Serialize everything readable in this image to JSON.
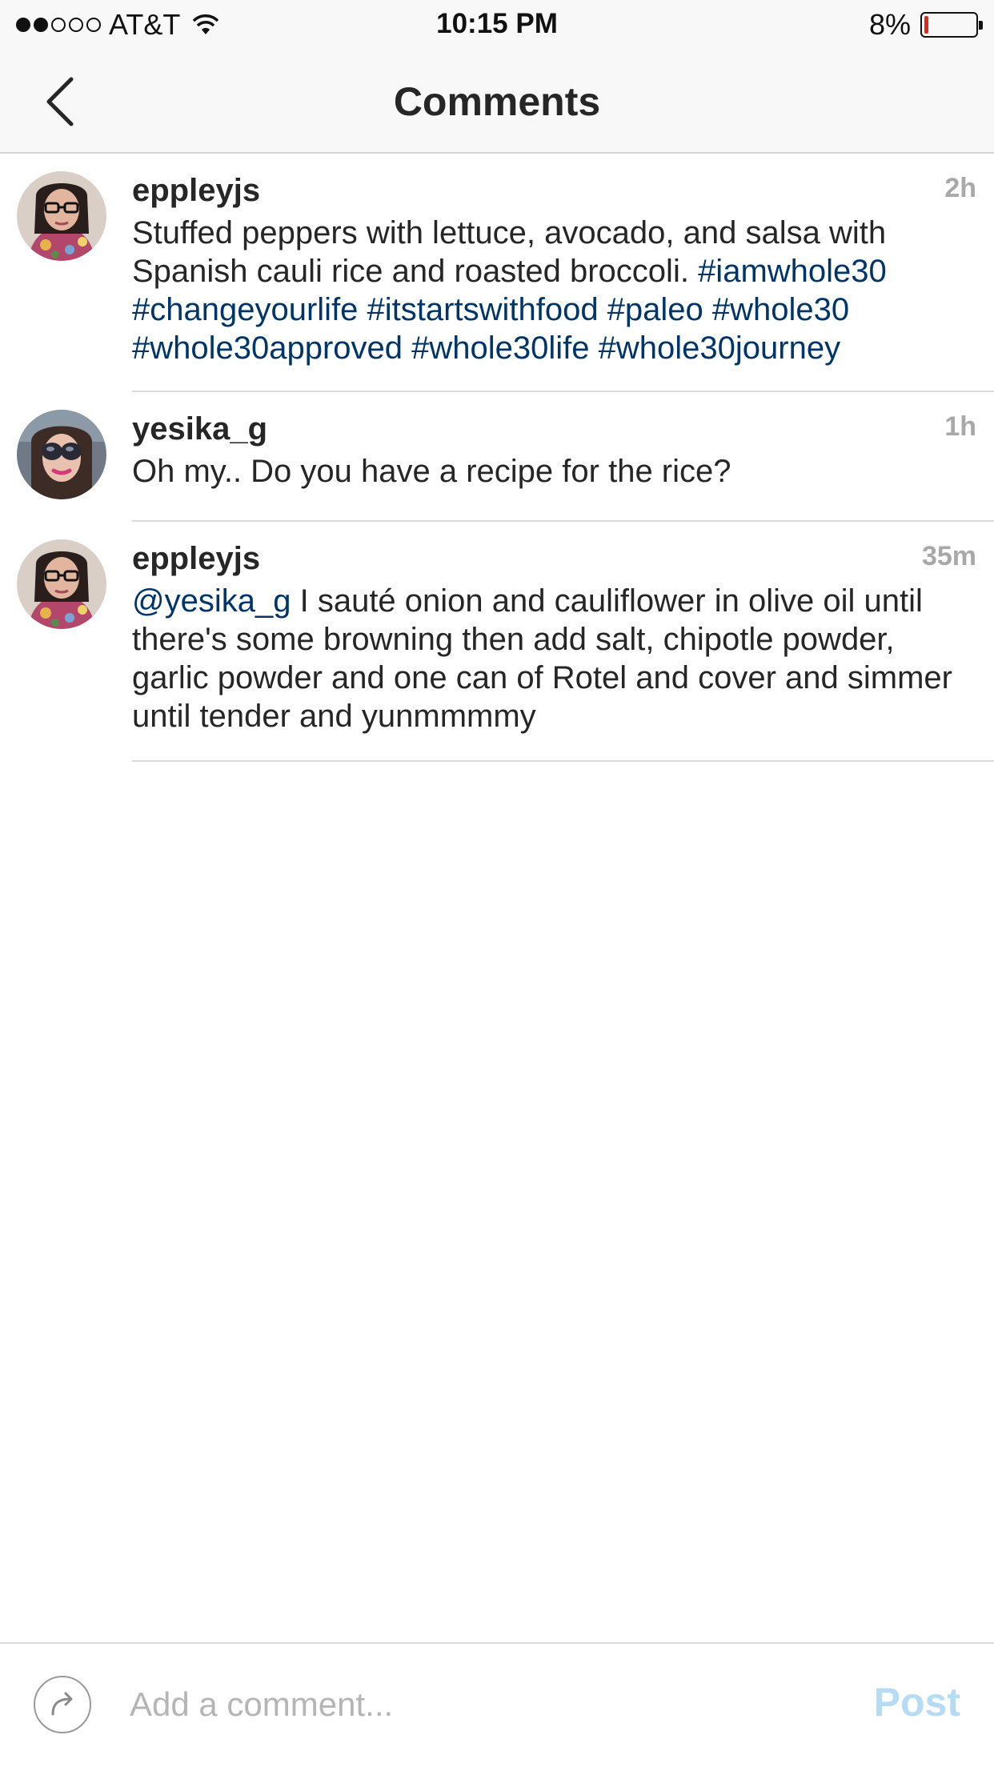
{
  "status_bar": {
    "signal_filled": 2,
    "signal_total": 5,
    "carrier": "AT&T",
    "time": "10:15 PM",
    "battery": "8%",
    "battery_level": 0.08,
    "battery_color": "#e0281a"
  },
  "nav": {
    "title": "Comments",
    "back_icon": "chevron-left-icon"
  },
  "comments": [
    {
      "username": "eppleyjs",
      "time": "2h",
      "text_plain": "Stuffed peppers with lettuce, avocado, and salsa with Spanish cauli rice and roasted broccoli. ",
      "hashtags": "#iamwhole30 #changeyourlife #itstartswithfood #paleo #whole30 #whole30approved #whole30life #whole30journey"
    },
    {
      "username": "yesika_g",
      "time": "1h",
      "text_plain": "Oh my.. Do you have a recipe for the rice?"
    },
    {
      "username": "eppleyjs",
      "time": "35m",
      "mention": "@yesika_g",
      "text_plain": " I sauté onion and cauliflower in olive oil until there's some browning then add salt, chipotle powder, garlic powder and one can of Rotel and cover and simmer until tender and yunmmmmy"
    }
  ],
  "composer": {
    "placeholder": "Add a comment...",
    "post_label": "Post",
    "share_icon": "share-arrow-icon"
  },
  "colors": {
    "link": "#003569",
    "post_disabled": "#b5dcf4",
    "timestamp": "#a8a8a8"
  }
}
